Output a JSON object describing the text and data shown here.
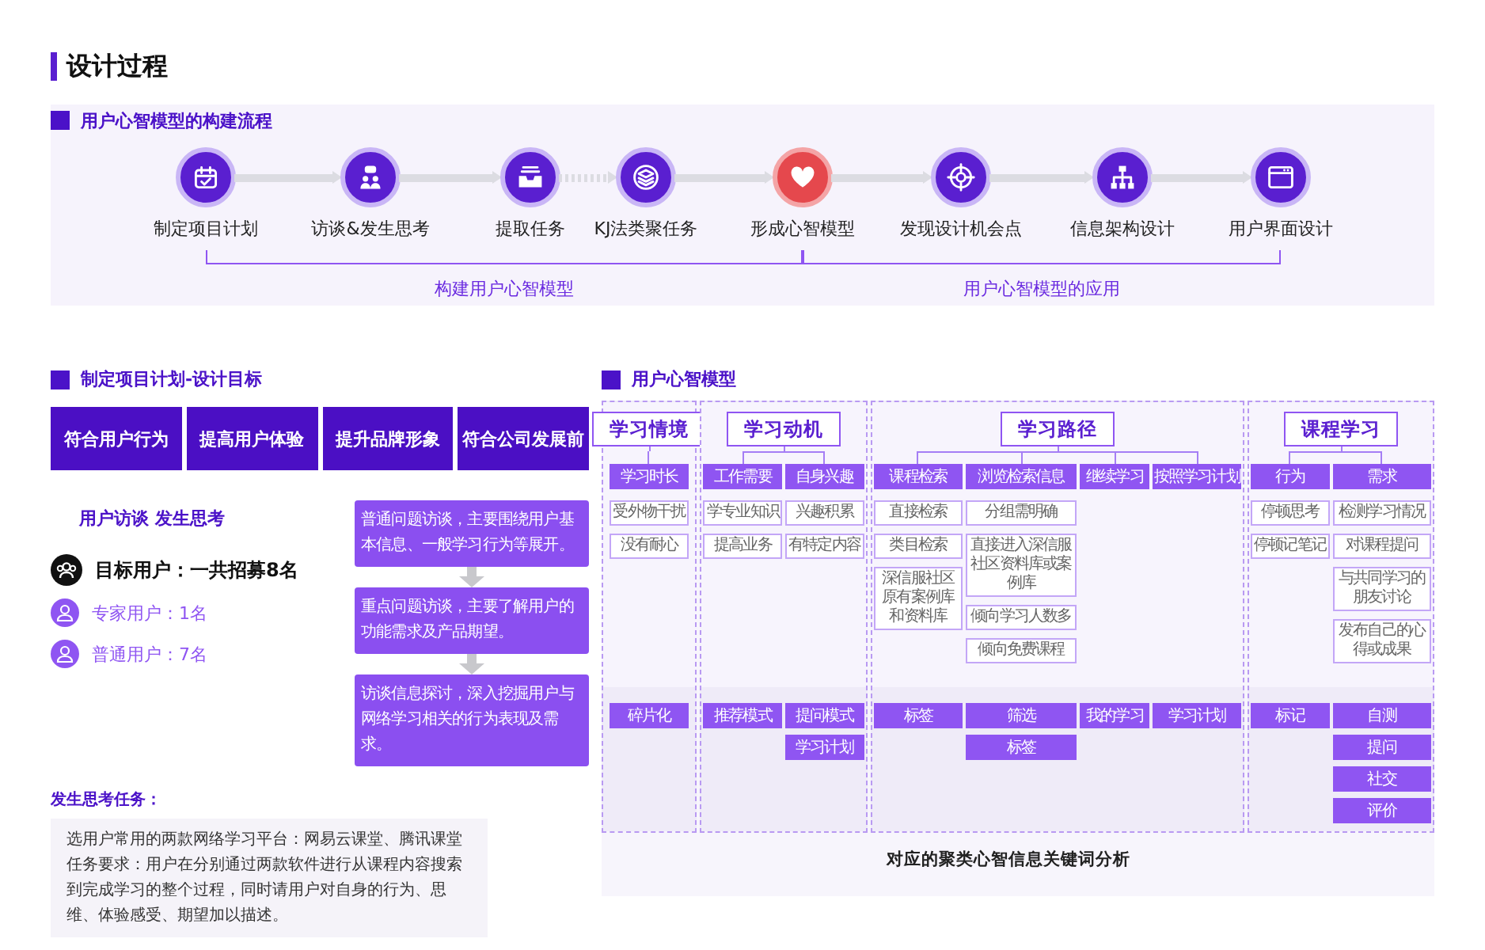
{
  "page_title": "设计过程",
  "flow": {
    "title": "用户心智模型的构建流程",
    "steps": [
      {
        "label": "制定项目计划",
        "highlighted": false
      },
      {
        "label": "访谈&发生思考",
        "highlighted": false
      },
      {
        "label": "提取任务",
        "highlighted": false
      },
      {
        "label": "KJ法类聚任务",
        "highlighted": false
      },
      {
        "label": "形成心智模型",
        "highlighted": true
      },
      {
        "label": "发现设计机会点",
        "highlighted": false
      },
      {
        "label": "信息架构设计",
        "highlighted": false
      },
      {
        "label": "用户界面设计",
        "highlighted": false
      }
    ],
    "connectors": [
      {
        "kind": "solid"
      },
      {
        "kind": "solid"
      },
      {
        "kind": "dotted"
      },
      {
        "kind": "solid"
      },
      {
        "kind": "solid"
      },
      {
        "kind": "solid"
      },
      {
        "kind": "solid"
      }
    ],
    "phases": [
      "构建用户心智模型",
      "用户心智模型的应用"
    ]
  },
  "plan": {
    "title": "制定项目计划-设计目标",
    "goals": [
      "符合用户行为",
      "提高用户体验",
      "提升品牌形象",
      "符合公司发展前"
    ],
    "interview_title": "用户访谈 发生思考",
    "target": "目标用户：一共招募8名",
    "user_groups": [
      "专家用户：1名",
      "普通用户：7名"
    ],
    "interview_steps": [
      "普通问题访谈，主要围绕用户基本信息、一般学习行为等展开。",
      "重点问题访谈，主要了解用户的功能需求及产品期望。",
      "访谈信息探讨，深入挖掘用户与网络学习相关的行为表现及需求。"
    ],
    "task_title": "发生思考任务：",
    "task_lines": [
      "选用户常用的两款网络学习平台：网易云课堂、腾讯课堂",
      "任务要求：用户在分别通过两款软件进行从课程内容搜索到完成学习的整个过程，同时请用户对自身的行为、思维、体验感受、期望加以描述。"
    ]
  },
  "model": {
    "title": "用户心智模型",
    "columns": [
      {
        "title": "学习情境",
        "groups": [
          {
            "label": "学习时长",
            "items": [
              "受外物干扰",
              "没有耐心"
            ],
            "keywords": [
              "碎片化"
            ]
          }
        ]
      },
      {
        "title": "学习动机",
        "groups": [
          {
            "label": "工作需要",
            "items": [
              "学专业知识",
              "提高业务"
            ],
            "keywords": [
              "推荐模式"
            ]
          },
          {
            "label": "自身兴趣",
            "items": [
              "兴趣积累",
              "有特定内容"
            ],
            "keywords": [
              "提问模式",
              "学习计划"
            ]
          }
        ]
      },
      {
        "title": "学习路径",
        "groups": [
          {
            "label": "课程检索",
            "items": [
              "直接检索",
              "类目检索",
              "深信服社区原有案例库和资料库"
            ],
            "keywords": [
              "标签"
            ]
          },
          {
            "label": "浏览检索信息",
            "items": [
              "分组需明确",
              "直接进入深信服社区资料库或案例库",
              "倾向学习人数多",
              "倾向免费课程"
            ],
            "keywords": [
              "筛选",
              "标签"
            ]
          },
          {
            "label": "继续学习",
            "keywords": [
              "我的学习"
            ]
          },
          {
            "label": "按照学习计划",
            "keywords": [
              "学习计划"
            ]
          }
        ]
      },
      {
        "title": "课程学习",
        "groups": [
          {
            "label": "行为",
            "items": [
              "停顿思考",
              "停顿记笔记"
            ],
            "keywords": [
              "标记"
            ]
          },
          {
            "label": "需求",
            "items": [
              "检测学习情况",
              "对课程提问",
              "与共同学习的朋友讨论",
              "发布自己的心得或成果"
            ],
            "keywords": [
              "自测",
              "提问",
              "社交",
              "评价"
            ]
          }
        ]
      }
    ],
    "caption": "对应的聚类心智信息关键词分析"
  }
}
